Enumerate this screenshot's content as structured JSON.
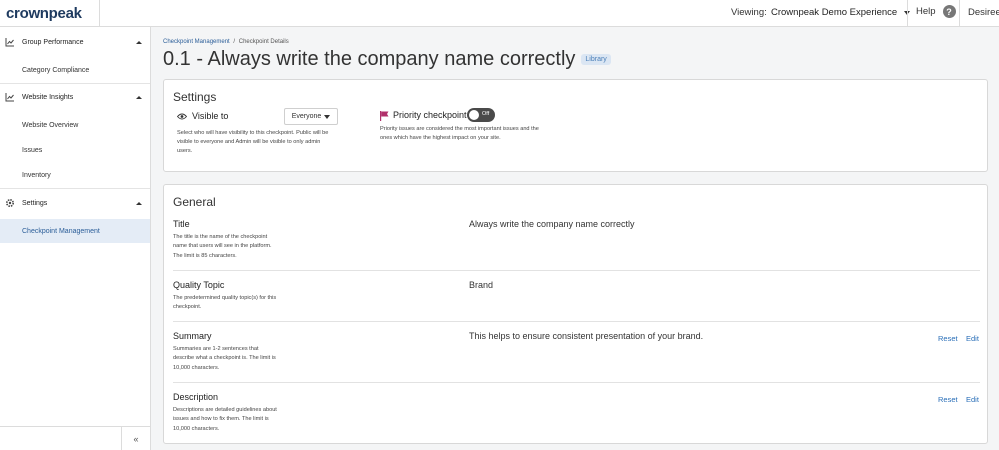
{
  "topbar": {
    "logo_text": "crownpeak",
    "viewing_label": "Viewing:",
    "experience": "Crownpeak Demo Experience",
    "help_label": "Help",
    "help_icon": "?",
    "user": "Desiree"
  },
  "sidebar": {
    "groups": [
      {
        "label": "Group Performance",
        "icon": "chart-icon"
      },
      {
        "label": "Website Insights",
        "icon": "chart-icon"
      },
      {
        "label": "Settings",
        "icon": "gear-icon"
      }
    ],
    "items": {
      "category_compliance": "Category Compliance",
      "website_overview": "Website Overview",
      "issues": "Issues",
      "inventory": "Inventory",
      "checkpoint_management": "Checkpoint Management"
    },
    "collapse_icon": "«"
  },
  "breadcrumb": {
    "parent": "Checkpoint Management",
    "separator": "/",
    "current": "Checkpoint Details"
  },
  "page": {
    "title": "0.1 - Always write the company name correctly",
    "badge": "Library"
  },
  "settings": {
    "title": "Settings",
    "visible_to_label": "Visible to",
    "visible_to_value": "Everyone",
    "visible_help": "Select who will have visibility to this checkpoint. Public will be visible to everyone and Admin will be visible to only admin users.",
    "priority_label": "Priority checkpoint",
    "priority_toggle": "Off",
    "priority_help": "Priority issues are considered the most important issues and the ones which have the highest impact on your site."
  },
  "general": {
    "title": "General",
    "fields": [
      {
        "name": "Title",
        "desc": "The title is the name of the checkpoint name that users will see in the platform. The limit is 85 characters.",
        "value": "Always write the company name correctly"
      },
      {
        "name": "Quality Topic",
        "desc": "The predetermined quality topic(s) for this checkpoint.",
        "value": "Brand"
      },
      {
        "name": "Summary",
        "desc": "Summaries are 1-2 sentences that describe what a checkpoint is. The limit is 10,000 characters.",
        "value": "This helps to ensure consistent presentation of your brand."
      },
      {
        "name": "Description",
        "desc": "Descriptions are detailed guidelines about issues and how to fix them. The limit is 10,000 characters.",
        "value": ""
      }
    ],
    "reset_label": "Reset",
    "edit_label": "Edit"
  },
  "colors": {
    "accent": "#2a5d98",
    "flag": "#b0306a",
    "toggle_off": "#4a4a4a"
  }
}
